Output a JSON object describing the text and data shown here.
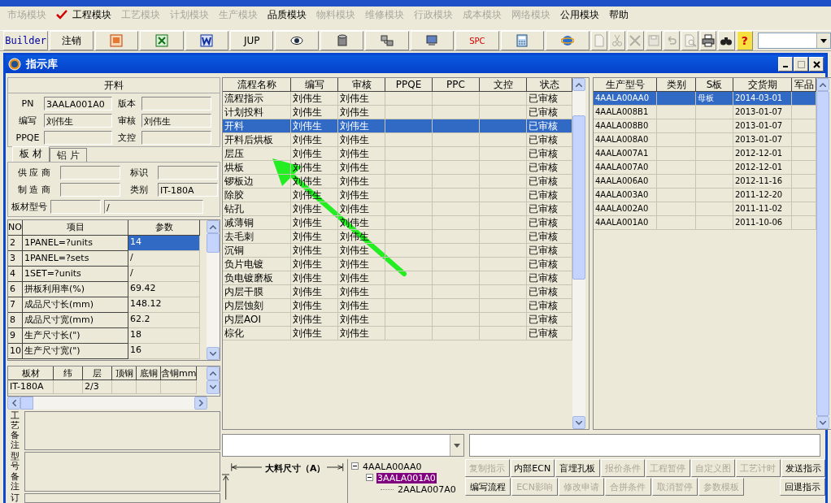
{
  "app_menu": [
    {
      "label": "市场模块",
      "disabled": true,
      "checked": false
    },
    {
      "label": "工程模块",
      "disabled": false,
      "checked": true
    },
    {
      "label": "工艺模块",
      "disabled": true,
      "checked": false
    },
    {
      "label": "计划模块",
      "disabled": true,
      "checked": false
    },
    {
      "label": "生产模块",
      "disabled": true,
      "checked": false
    },
    {
      "label": "品质模块",
      "disabled": false,
      "checked": false
    },
    {
      "label": "物料模块",
      "disabled": true,
      "checked": false
    },
    {
      "label": "维修模块",
      "disabled": true,
      "checked": false
    },
    {
      "label": "行政模块",
      "disabled": true,
      "checked": false
    },
    {
      "label": "成本模块",
      "disabled": true,
      "checked": false
    },
    {
      "label": "网络模块",
      "disabled": true,
      "checked": false
    },
    {
      "label": "公用模块",
      "disabled": false,
      "checked": false
    },
    {
      "label": "帮助",
      "disabled": false,
      "checked": false
    }
  ],
  "toolbar": [
    {
      "kind": "text",
      "label": "Builder"
    },
    {
      "kind": "text",
      "label": "注销"
    },
    {
      "kind": "icon",
      "disabled": false
    },
    {
      "kind": "icon",
      "disabled": false
    },
    {
      "kind": "icon",
      "disabled": false
    },
    {
      "kind": "text",
      "label": "JUP"
    },
    {
      "kind": "icon",
      "disabled": false
    },
    {
      "kind": "icon",
      "disabled": false
    },
    {
      "kind": "icon",
      "disabled": false
    },
    {
      "kind": "icon",
      "disabled": false
    },
    {
      "kind": "text",
      "label": "SPC"
    },
    {
      "kind": "icon",
      "disabled": false
    },
    {
      "kind": "icon",
      "disabled": false
    },
    {
      "kind": "icon",
      "disabled": true
    },
    {
      "kind": "icon",
      "disabled": true
    },
    {
      "kind": "icon",
      "disabled": true
    },
    {
      "kind": "icon",
      "disabled": true
    },
    {
      "kind": "icon",
      "disabled": true
    },
    {
      "kind": "icon",
      "disabled": true
    },
    {
      "kind": "icon",
      "disabled": false
    },
    {
      "kind": "icon",
      "disabled": false
    },
    {
      "kind": "help",
      "label": "?"
    },
    {
      "kind": "combo"
    }
  ],
  "window": {
    "title": "指示库"
  },
  "process_panel": {
    "title": "开料",
    "fields": [
      {
        "label": "PN",
        "value": "3AALA001A0"
      },
      {
        "label": "版本"
      },
      {
        "label": "编写",
        "value": "刘伟生"
      },
      {
        "label": "审核",
        "value": "刘伟生"
      },
      {
        "label": "PPQE"
      },
      {
        "label": "文控"
      }
    ],
    "tabs": [
      {
        "label": "板 材",
        "selected": true
      },
      {
        "label": "铝 片",
        "selected": false
      }
    ],
    "material_fields": [
      {
        "label": "供 应 商"
      },
      {
        "label": "标识"
      },
      {
        "label": "制 造 商"
      },
      {
        "label": "类别",
        "value": "IT-180A"
      }
    ],
    "material_model": {
      "label": "板材型号",
      "value": "/"
    },
    "params": {
      "columns": [
        "NO",
        "项目",
        "参数"
      ],
      "rows": [
        {
          "no": "2",
          "item": "1PANEL=?units",
          "value": "14",
          "selected": true
        },
        {
          "no": "3",
          "item": "1PANEL=?sets",
          "value": "/",
          "selected": false
        },
        {
          "no": "4",
          "item": "1SET=?units",
          "value": "/",
          "selected": false
        },
        {
          "no": "6",
          "item": "拼板利用率(%)",
          "value": "69.42",
          "selected": false
        },
        {
          "no": "7",
          "item": "成品尺寸长(mm)",
          "value": "148.12",
          "selected": false
        },
        {
          "no": "8",
          "item": "成品尺寸宽(mm)",
          "value": "62.2",
          "selected": false
        },
        {
          "no": "9",
          "item": "生产尺寸长(\")",
          "value": "18",
          "selected": false
        },
        {
          "no": "10",
          "item": "生产尺寸宽(\")",
          "value": "16",
          "selected": false
        }
      ]
    },
    "material_grid": {
      "columns": [
        "板材",
        "纬",
        "层",
        "顶铜",
        "底铜",
        "含铜mm"
      ],
      "rows": [
        {
          "board": "IT-180A",
          "layer": "2/3"
        }
      ]
    },
    "remarks": [
      {
        "label": "工艺备注"
      },
      {
        "label": "型号备注"
      },
      {
        "label": "订"
      }
    ]
  },
  "process_table": {
    "columns": [
      "流程名称",
      "编写",
      "审核",
      "PPQE",
      "PPC",
      "文控",
      "状态"
    ],
    "rows": [
      {
        "name": "流程指示",
        "writer": "刘伟生",
        "reviewer": "刘伟生",
        "status": "已审核",
        "selected": false
      },
      {
        "name": "计划投料",
        "writer": "刘伟生",
        "reviewer": "刘伟生",
        "status": "已审核",
        "selected": false
      },
      {
        "name": "开料",
        "writer": "刘伟生",
        "reviewer": "刘伟生",
        "status": "已审核",
        "selected": true
      },
      {
        "name": "开料后烘板",
        "writer": "刘伟生",
        "reviewer": "刘伟生",
        "status": "已审核",
        "selected": false
      },
      {
        "name": "层压",
        "writer": "刘伟生",
        "reviewer": "刘伟生",
        "status": "已审核",
        "selected": false
      },
      {
        "name": "烘板",
        "writer": "刘伟生",
        "reviewer": "刘伟生",
        "status": "已审核",
        "selected": false
      },
      {
        "name": "锣板边",
        "writer": "刘伟生",
        "reviewer": "刘伟生",
        "status": "已审核",
        "selected": false
      },
      {
        "name": "除胶",
        "writer": "刘伟生",
        "reviewer": "刘伟生",
        "status": "已审核",
        "selected": false
      },
      {
        "name": "钻孔",
        "writer": "刘伟生",
        "reviewer": "刘伟生",
        "status": "已审核",
        "selected": false
      },
      {
        "name": "减薄铜",
        "writer": "刘伟生",
        "reviewer": "刘伟生",
        "status": "已审核",
        "selected": false
      },
      {
        "name": "去毛刺",
        "writer": "刘伟生",
        "reviewer": "刘伟生",
        "status": "已审核",
        "selected": false
      },
      {
        "name": "沉铜",
        "writer": "刘伟生",
        "reviewer": "刘伟生",
        "status": "已审核",
        "selected": false
      },
      {
        "name": "负片电镀",
        "writer": "刘伟生",
        "reviewer": "刘伟生",
        "status": "已审核",
        "selected": false
      },
      {
        "name": "负电镀磨板",
        "writer": "刘伟生",
        "reviewer": "刘伟生",
        "status": "已审核",
        "selected": false
      },
      {
        "name": "内层干膜",
        "writer": "刘伟生",
        "reviewer": "刘伟生",
        "status": "已审核",
        "selected": false
      },
      {
        "name": "内层蚀刻",
        "writer": "刘伟生",
        "reviewer": "刘伟生",
        "status": "已审核",
        "selected": false
      },
      {
        "name": "内层AOI",
        "writer": "刘伟生",
        "reviewer": "刘伟生",
        "status": "已审核",
        "selected": false
      },
      {
        "name": "棕化",
        "writer": "刘伟生",
        "reviewer": "刘伟生",
        "status": "已审核",
        "selected": false
      }
    ]
  },
  "model_table": {
    "columns": [
      "生产型号",
      "类别",
      "S板",
      "交货期",
      "军品"
    ],
    "rows": [
      {
        "model": "4AALA00AA0",
        "s_board": "母板",
        "delivery": "2014-03-01",
        "selected": true
      },
      {
        "model": "4AALA008B1",
        "delivery": "2013-01-07",
        "selected": false
      },
      {
        "model": "4AALA008B0",
        "delivery": "2013-01-07",
        "selected": false
      },
      {
        "model": "4AALA008A0",
        "delivery": "2013-01-07",
        "selected": false
      },
      {
        "model": "4AALA007A1",
        "delivery": "2012-12-01",
        "selected": false
      },
      {
        "model": "4AALA007A0",
        "delivery": "2012-12-01",
        "selected": false
      },
      {
        "model": "4AALA006A0",
        "delivery": "2012-11-16",
        "selected": false
      },
      {
        "model": "4AALA003A0",
        "delivery": "2011-12-20",
        "selected": false
      },
      {
        "model": "4AALA002A0",
        "delivery": "2011-11-02",
        "selected": false
      },
      {
        "model": "4AALA001A0",
        "delivery": "2011-10-06",
        "selected": false
      }
    ]
  },
  "dimension": {
    "label": "大料尺寸（A）"
  },
  "tree": [
    {
      "label": "4AALA00AA0",
      "expanded": true,
      "selected": false,
      "children": [
        {
          "label": "3AALA001A0",
          "expanded": true,
          "selected": true,
          "children": [
            {
              "label": "2AALA007A0",
              "selected": false
            }
          ]
        }
      ]
    }
  ],
  "actions": [
    [
      {
        "label": "复制指示",
        "disabled": true
      },
      {
        "label": "内部ECN",
        "disabled": false
      },
      {
        "label": "盲埋孔板",
        "disabled": false
      },
      {
        "label": "报价条件",
        "disabled": true
      },
      {
        "label": "工程暂停",
        "disabled": true
      },
      {
        "label": "自定义图",
        "disabled": true
      },
      {
        "label": "工艺计时",
        "disabled": true
      },
      {
        "label": "发送指示",
        "disabled": false
      }
    ],
    [
      {
        "label": "编写流程",
        "disabled": false
      },
      {
        "label": "ECN影响",
        "disabled": true
      },
      {
        "label": "修改申请",
        "disabled": true
      },
      {
        "label": "合拼条件",
        "disabled": true
      },
      {
        "label": "取消暂停",
        "disabled": true
      },
      {
        "label": "参数模板",
        "disabled": true
      },
      {
        "label": "回退指示",
        "disabled": false
      }
    ]
  ]
}
